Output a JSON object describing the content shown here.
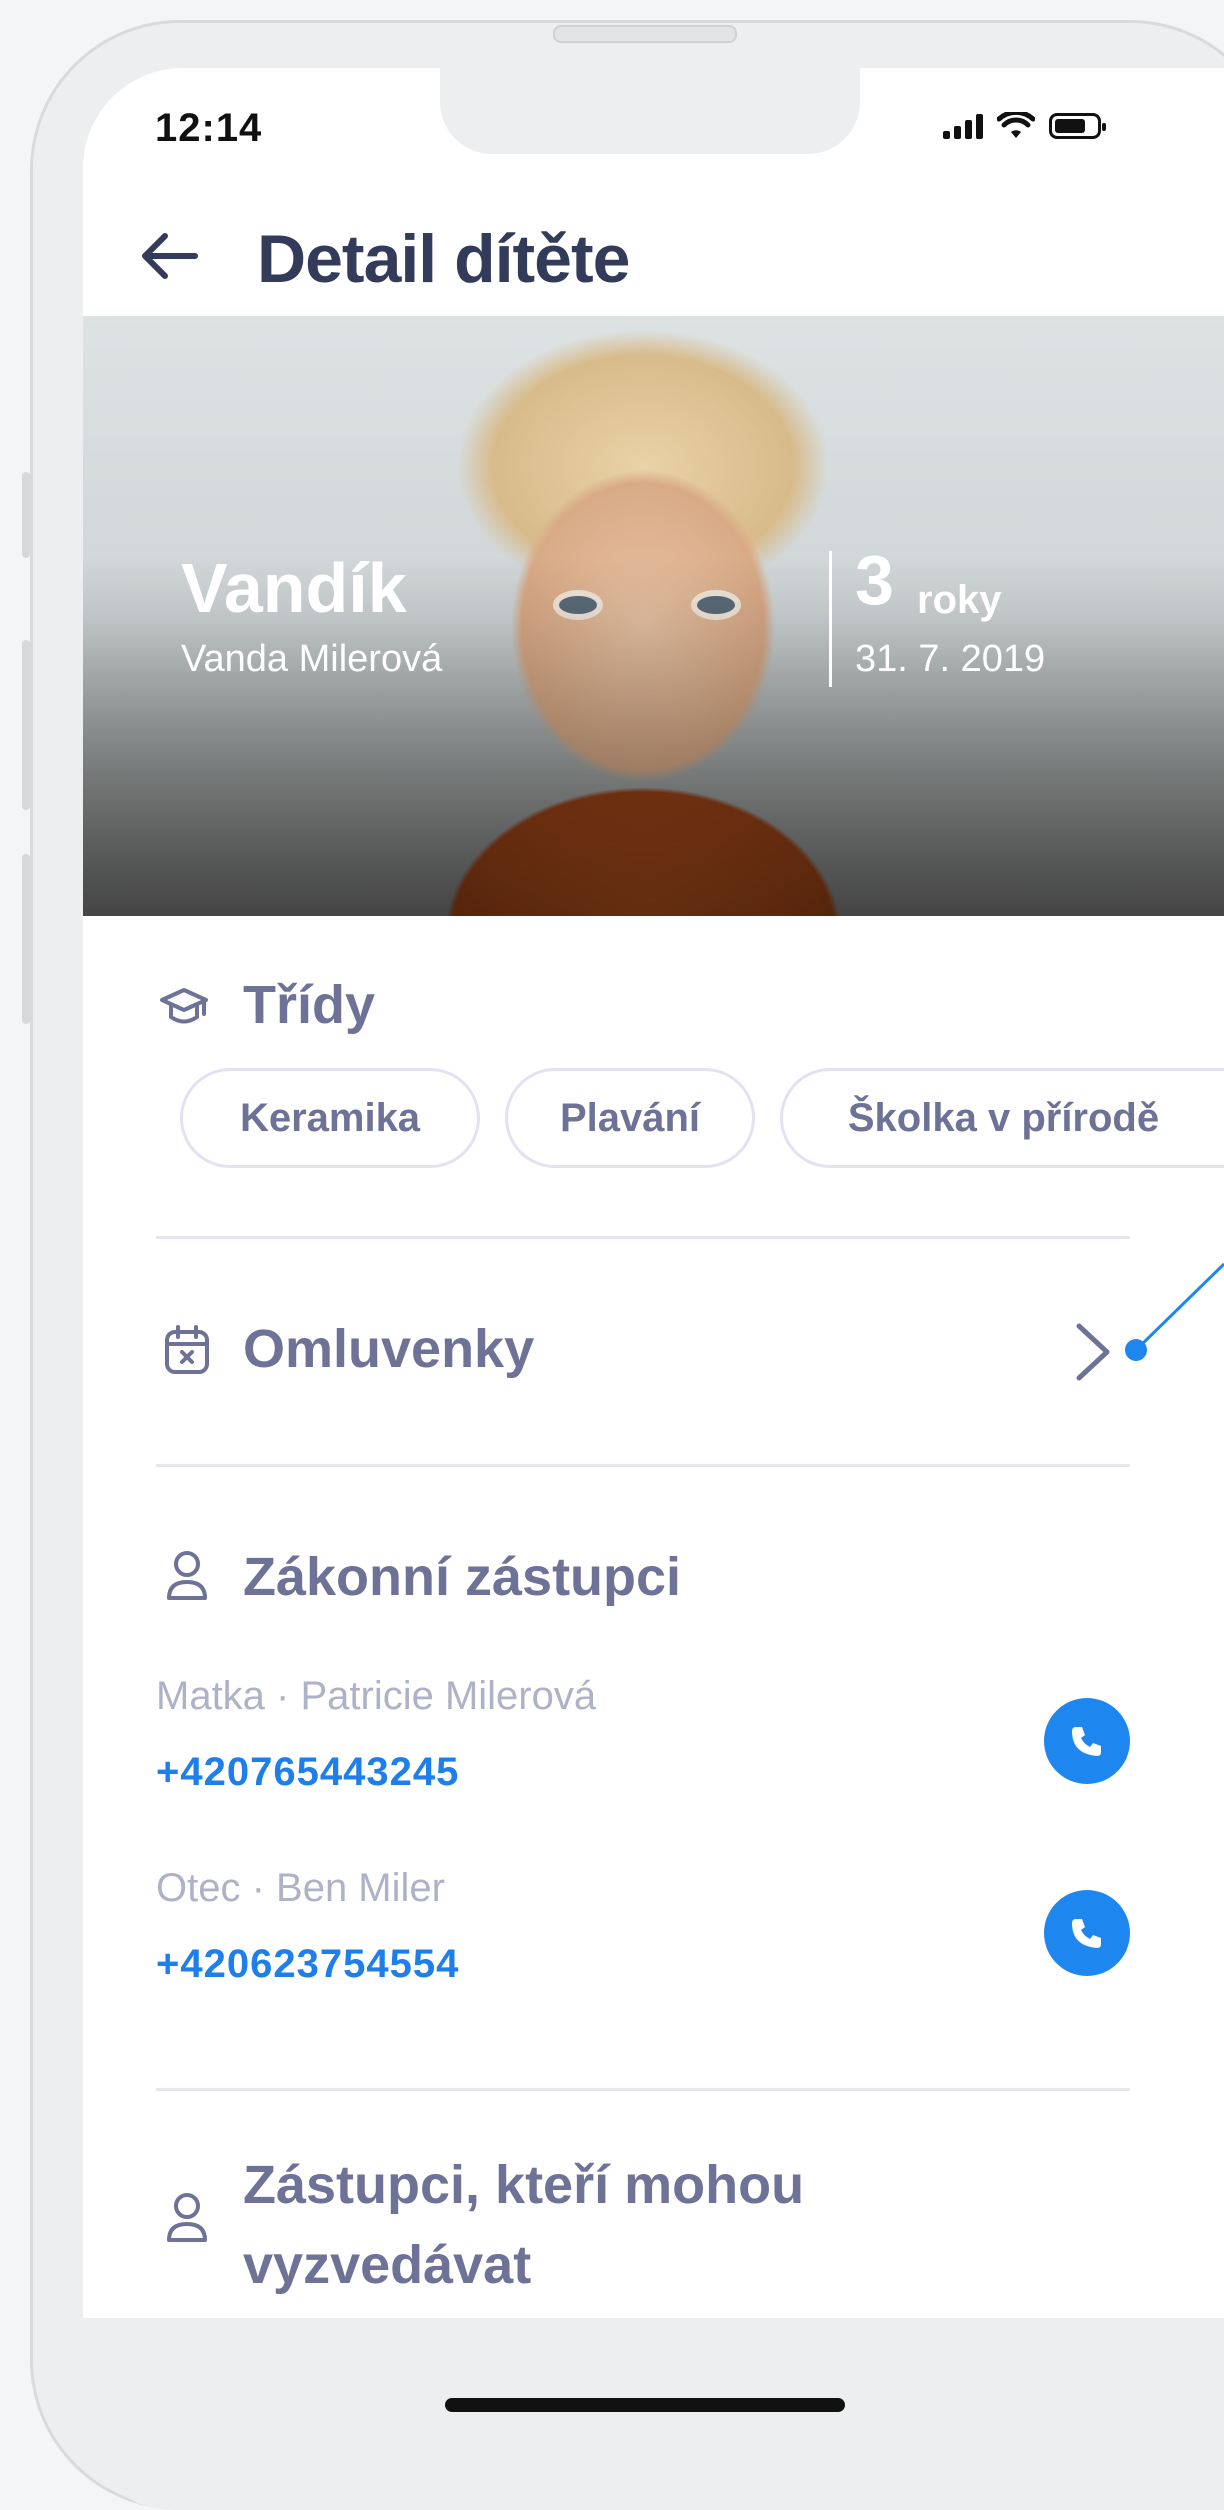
{
  "status_bar": {
    "time": "12:14"
  },
  "header": {
    "title": "Detail dítěte"
  },
  "child": {
    "nickname": "Vandík",
    "full_name": "Vanda Milerová",
    "age_number": "3",
    "age_unit": "roky",
    "birth_date": "31. 7. 2019"
  },
  "classes": {
    "title": "Třídy",
    "items": [
      "Keramika",
      "Plavání",
      "Školka v přírodě"
    ]
  },
  "excuses": {
    "title": "Omluvenky"
  },
  "guardians": {
    "title": "Zákonní zástupci",
    "items": [
      {
        "label": "Matka · Patricie Milerová",
        "phone": "+420765443245"
      },
      {
        "label": "Otec · Ben Miler",
        "phone": "+420623754554"
      }
    ]
  },
  "pickup": {
    "title_line1": "Zástupci, kteří mohou",
    "title_line2": "vyzvedávat"
  },
  "colors": {
    "accent": "#1e86ef",
    "title": "#333b5a",
    "section": "#6e7297",
    "muted": "#aeb2c6"
  }
}
